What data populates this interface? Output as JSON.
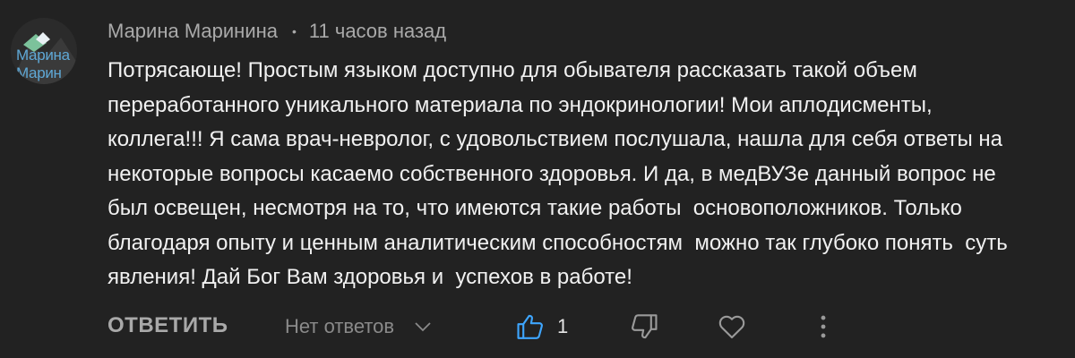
{
  "comment": {
    "author": "Марина Маринина",
    "separator": "•",
    "time": "11 часов назад",
    "text": "Потрясающе! Простым языком доступно для обывателя рассказать такой объем\nпереработанного уникального материала по эндокринологии! Мои аплодисменты,\nколлега!!! Я сама врач-невролог, с удовольствием послушала, нашла для себя ответы на\nнекоторые вопросы касаемо собственного здоровья. И да, в медВУЗе данный вопрос не\nбыл освещен, несмотря на то, что имеются такие работы  основоположников. Только\nблагодаря опыту и ценным аналитическим способностям  можно так глубоко понять  суть\nявления! Дай Бог Вам здоровья и  успехов в работе!",
    "avatar": {
      "line1": "Марина",
      "line2": "Марин"
    }
  },
  "actions": {
    "reply_label": "ОТВЕТИТЬ",
    "replies_label": "Нет ответов",
    "like_count": "1"
  },
  "icons": {
    "like": "thumbs-up-icon",
    "dislike": "thumbs-down-icon",
    "heart": "heart-icon",
    "more": "more-vertical-icon",
    "chevron": "chevron-down-icon"
  },
  "colors": {
    "background": "#222222",
    "text": "#f1f1f1",
    "meta": "#aaaaaa",
    "like_accent": "#3ea6ff",
    "avatar_text": "#5fa8d6"
  }
}
